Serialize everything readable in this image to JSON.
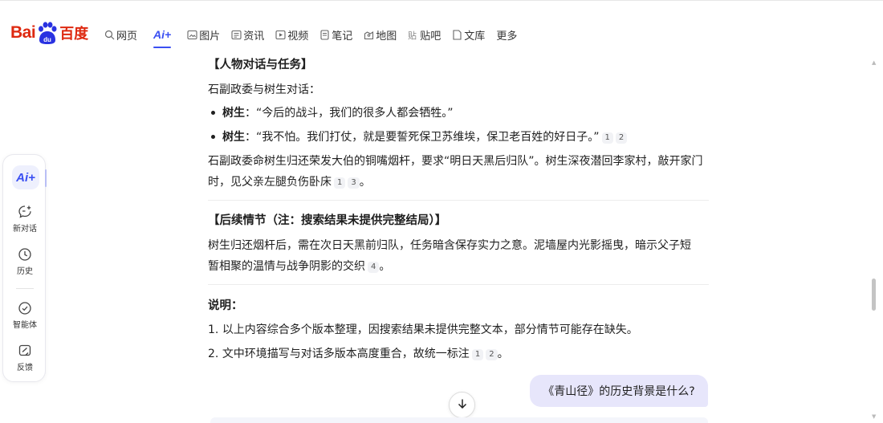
{
  "header": {
    "logo_text_en": "Bai",
    "logo_text_du": "du",
    "logo_text_cn": "百度",
    "nav": [
      {
        "label": "网页",
        "icon": "search-icon"
      },
      {
        "label": "Ai+",
        "icon": "ai-icon",
        "active": true
      },
      {
        "label": "图片",
        "icon": "image-icon"
      },
      {
        "label": "资讯",
        "icon": "news-icon"
      },
      {
        "label": "视频",
        "icon": "video-icon"
      },
      {
        "label": "笔记",
        "icon": "note-icon"
      },
      {
        "label": "地图",
        "icon": "map-icon"
      },
      {
        "label": "贴吧",
        "icon": "tieba-icon"
      },
      {
        "label": "文库",
        "icon": "doc-icon"
      },
      {
        "label": "更多",
        "icon": ""
      }
    ]
  },
  "sidebar": {
    "ai_label": "Ai+",
    "items": [
      {
        "label": "新对话",
        "icon": "new-chat-icon"
      },
      {
        "label": "历史",
        "icon": "clock-icon"
      },
      {
        "label": "智能体",
        "icon": "agent-icon"
      },
      {
        "label": "反馈",
        "icon": "feedback-icon"
      }
    ]
  },
  "content": {
    "top_heading": "【人物对话与任务】",
    "dialog_intro": "石副政委与树生对话：",
    "bullets": [
      {
        "speaker": "树生",
        "text": "：“今后的战斗，我们的很多人都会牺牲。”",
        "cites": []
      },
      {
        "speaker": "树生",
        "text": "：“我不怕。我们打仗，就是要誓死保卫苏维埃，保卫老百姓的好日子。”",
        "cites": [
          "1",
          "2"
        ]
      }
    ],
    "para1_line1": "石副政委命树生归还荣发大伯的铜嘴烟杆，要求“明日天黑后归队”。树生深夜潜回李家村，敲开家门",
    "para1_line2": "时，见父亲左腿负伤卧床",
    "para1_cites": [
      "1",
      "3"
    ],
    "para1_end": "。",
    "section2_heading": "【后续情节（注：搜索结果未提供完整结局）】",
    "para2_line1": "树生归还烟杆后，需在次日天黑前归队，任务暗含保存实力之意。泥墙屋内光影摇曳，暗示父子短",
    "para2_line2": "暂相聚的温情与战争阴影的交织",
    "para2_cites": [
      "4"
    ],
    "para2_end": "。",
    "notes_heading": "说明：",
    "notes": [
      {
        "num": "1.",
        "text": "以上内容综合多个版本整理，因搜索结果未提供完整文本，部分情节可能存在缺失。",
        "cites": [],
        "end": ""
      },
      {
        "num": "2.",
        "text": "文中环境描写与对话多版本高度重合，故统一标注",
        "cites": [
          "1",
          "2"
        ],
        "end": "。"
      }
    ]
  },
  "user_message": "《青山径》的历史背景是什么?",
  "colors": {
    "brand_red": "#de2910",
    "brand_blue": "#2932e1",
    "ai_accent": "#3a4ff2",
    "bubble": "#e7e6fb"
  }
}
